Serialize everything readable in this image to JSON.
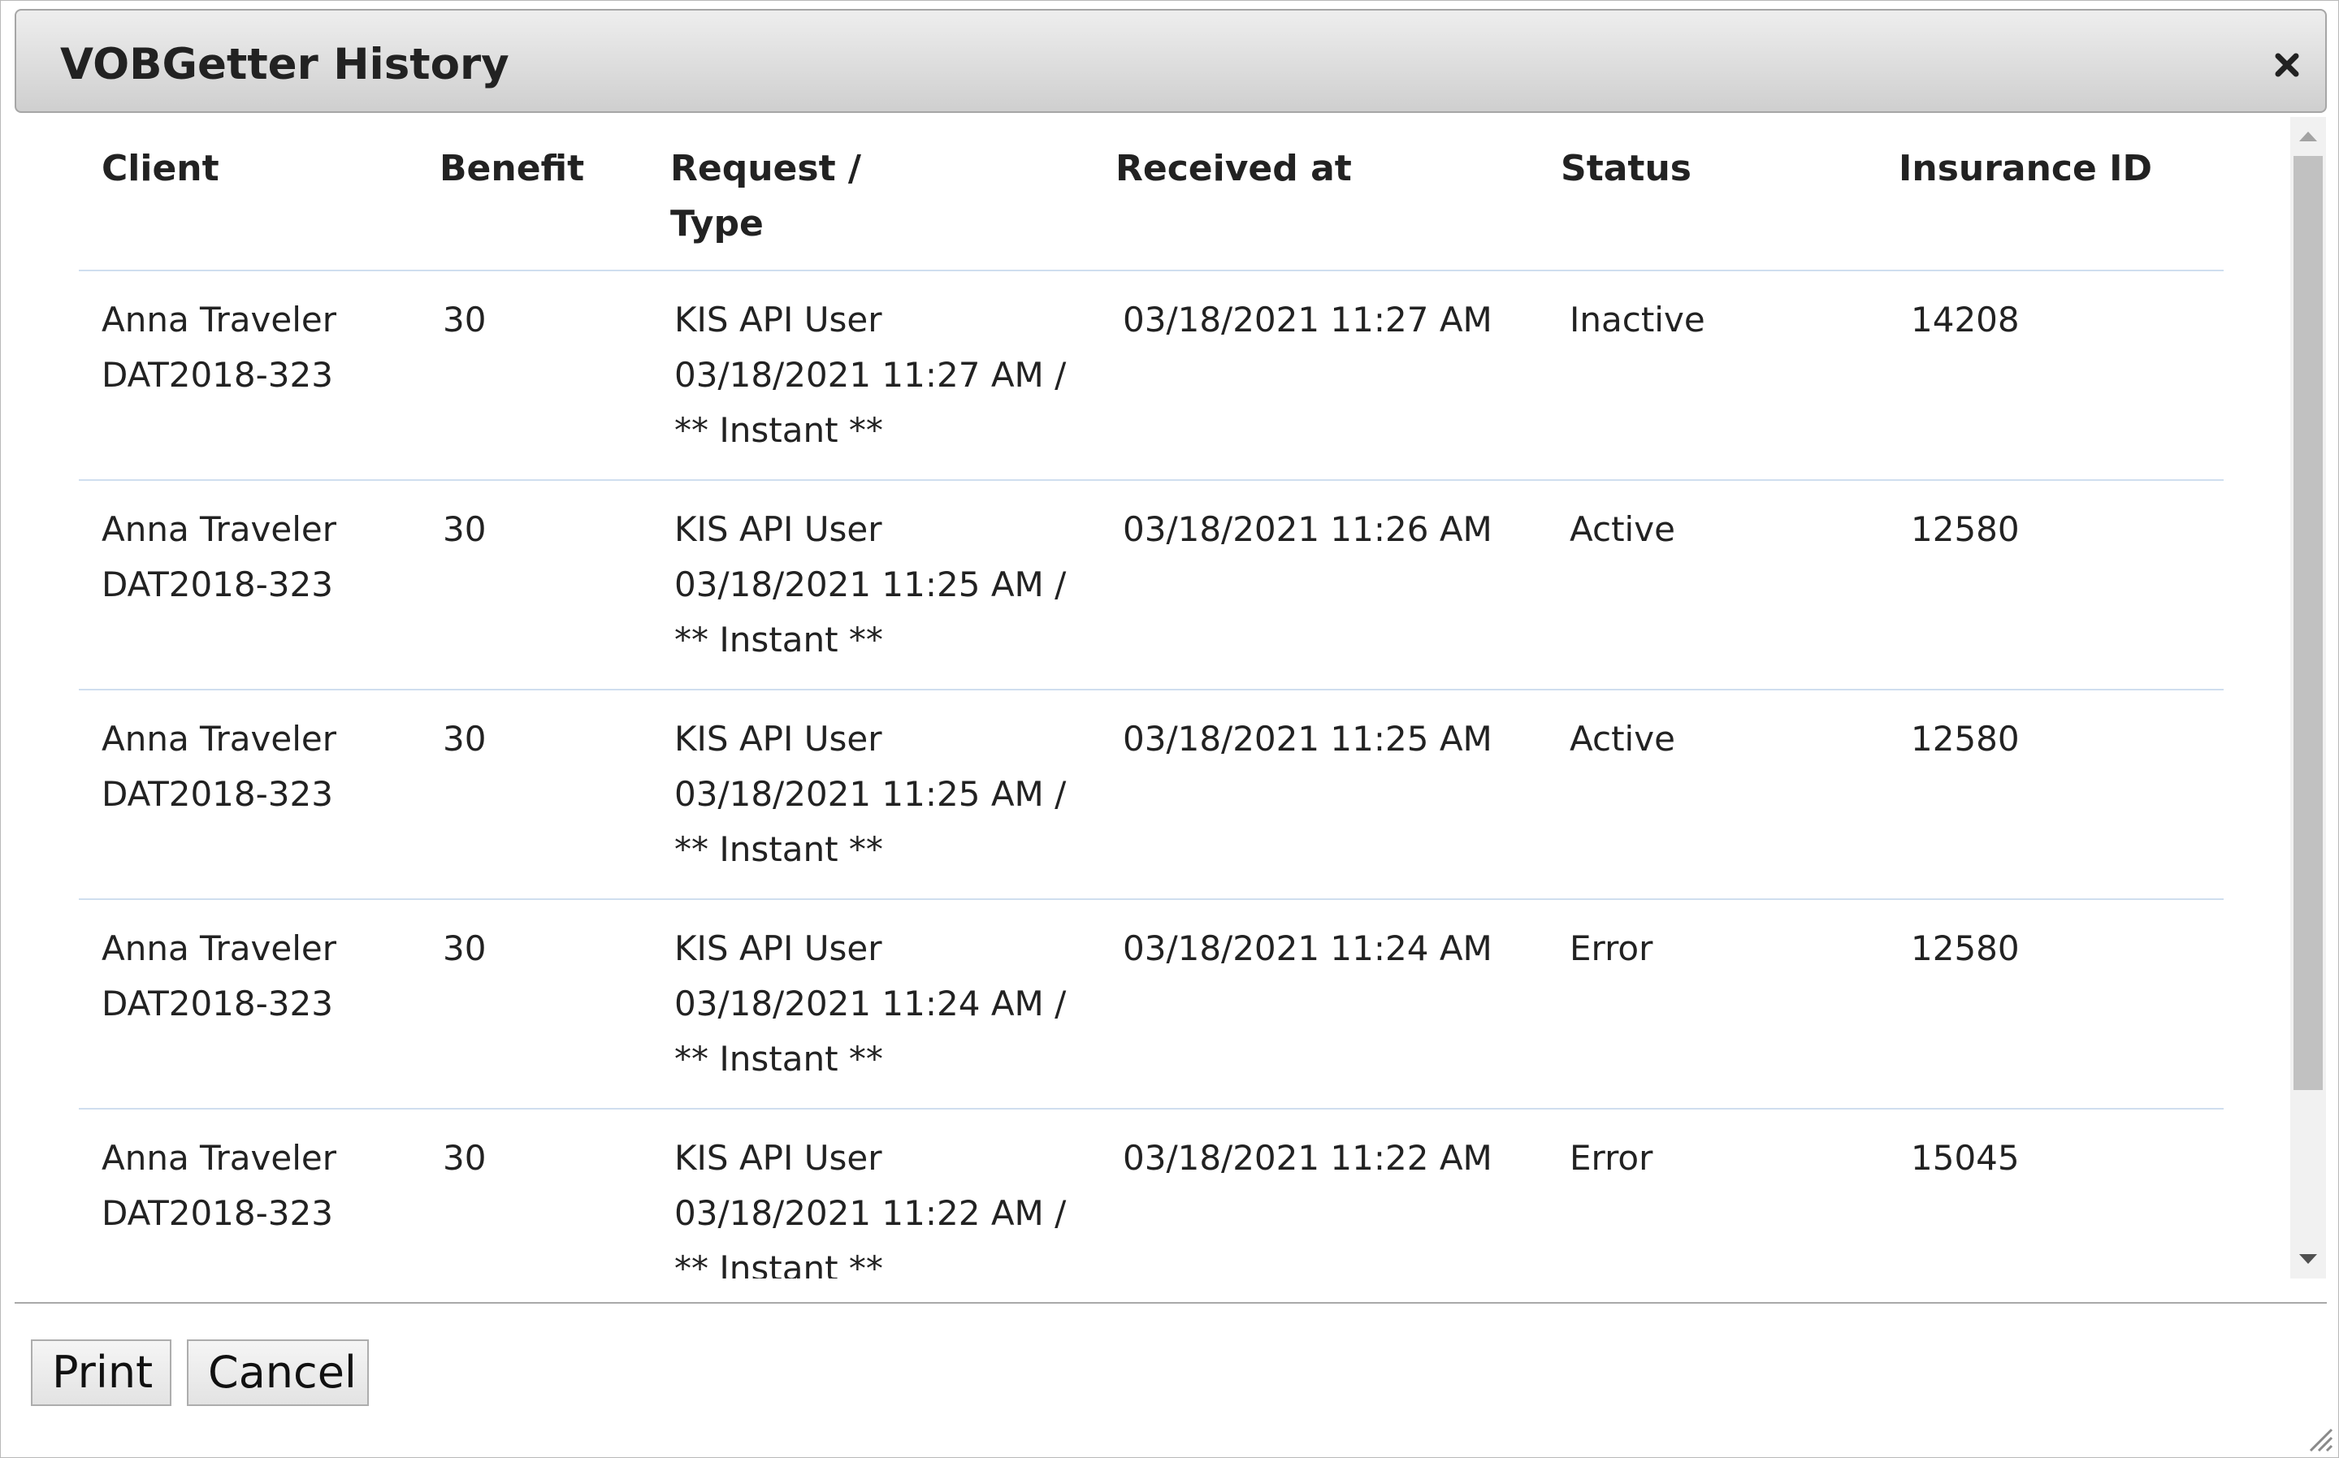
{
  "dialog": {
    "title": "VOBGetter History"
  },
  "table": {
    "headers": {
      "client": "Client",
      "benefit": "Benefit",
      "request_line1": "Request /",
      "request_line2": "Type",
      "received": "Received at",
      "status": "Status",
      "insurance_id": "Insurance ID"
    },
    "rows": [
      {
        "client_name": "Anna Traveler",
        "client_id": "DAT2018-323",
        "benefit": "30",
        "request_user": "KIS API User",
        "request_time": "03/18/2021 11:27 AM /",
        "request_type": "** Instant **",
        "received": "03/18/2021 11:27 AM",
        "status": "Inactive",
        "insurance_id": "14208"
      },
      {
        "client_name": "Anna Traveler",
        "client_id": "DAT2018-323",
        "benefit": "30",
        "request_user": "KIS API User",
        "request_time": "03/18/2021 11:25 AM /",
        "request_type": "** Instant **",
        "received": "03/18/2021 11:26 AM",
        "status": "Active",
        "insurance_id": "12580"
      },
      {
        "client_name": "Anna Traveler",
        "client_id": "DAT2018-323",
        "benefit": "30",
        "request_user": "KIS API User",
        "request_time": "03/18/2021 11:25 AM /",
        "request_type": "** Instant **",
        "received": "03/18/2021 11:25 AM",
        "status": "Active",
        "insurance_id": "12580"
      },
      {
        "client_name": "Anna Traveler",
        "client_id": "DAT2018-323",
        "benefit": "30",
        "request_user": "KIS API User",
        "request_time": "03/18/2021 11:24 AM /",
        "request_type": "** Instant **",
        "received": "03/18/2021 11:24 AM",
        "status": "Error",
        "insurance_id": "12580"
      },
      {
        "client_name": "Anna Traveler",
        "client_id": "DAT2018-323",
        "benefit": "30",
        "request_user": "KIS API User",
        "request_time": "03/18/2021 11:22 AM /",
        "request_type": "** Instant **",
        "received": "03/18/2021 11:22 AM",
        "status": "Error",
        "insurance_id": "15045"
      }
    ]
  },
  "footer": {
    "print_label": "Print",
    "cancel_label": "Cancel"
  },
  "icons": {
    "close": "close-icon",
    "scroll_up": "chevron-up-icon",
    "scroll_down": "chevron-down-icon",
    "resize": "resize-grip-icon"
  },
  "colors": {
    "row_divider": "#cfdeef",
    "titlebar_top": "#eeeeee",
    "titlebar_bottom": "#cfcfcf"
  }
}
